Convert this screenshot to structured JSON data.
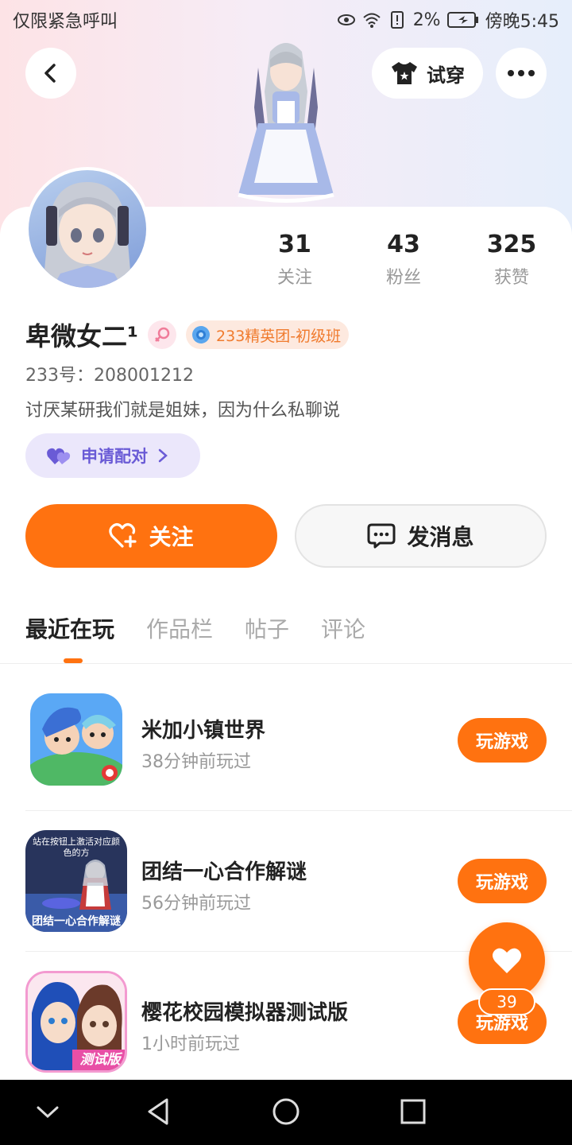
{
  "status_bar": {
    "left_text": "仅限紧急呼叫",
    "battery": "2%",
    "time": "傍晚5:45"
  },
  "header": {
    "try_on_label": "试穿"
  },
  "profile": {
    "name": "卑微女二¹",
    "tag_label": "233精英团-初级班",
    "uid": "233号：208001212",
    "bio": "讨厌某研我们就是姐妹，因为什么私聊说",
    "match_label": "申请配对",
    "stats": [
      {
        "num": "31",
        "label": "关注"
      },
      {
        "num": "43",
        "label": "粉丝"
      },
      {
        "num": "325",
        "label": "获赞"
      }
    ]
  },
  "actions": {
    "follow_label": "关注",
    "message_label": "发消息"
  },
  "tabs": [
    {
      "label": "最近在玩",
      "active": true
    },
    {
      "label": "作品栏",
      "active": false
    },
    {
      "label": "帖子",
      "active": false
    },
    {
      "label": "评论",
      "active": false
    }
  ],
  "games": [
    {
      "title": "米加小镇世界",
      "sub": "38分钟前玩过",
      "button": "玩游戏"
    },
    {
      "title": "团结一心合作解谜",
      "sub": "56分钟前玩过",
      "button": "玩游戏",
      "icon_text_top": "站在按钮上激活对应颜色的方",
      "icon_text_bottom": "团结一心合作解谜"
    },
    {
      "title": "樱花校园模拟器测试版",
      "sub": "1小时前玩过",
      "button": "玩游戏",
      "icon_badge": "测试版"
    }
  ],
  "fab": {
    "count": "39"
  },
  "colors": {
    "accent": "#ff7210",
    "match_text": "#6a5bd6"
  }
}
